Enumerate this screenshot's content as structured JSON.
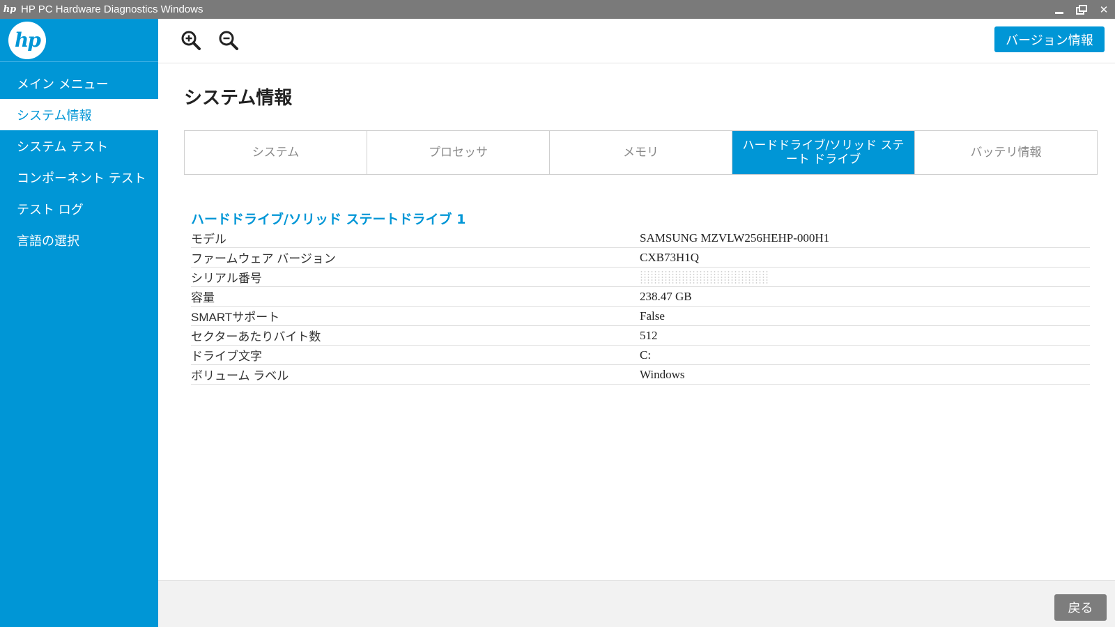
{
  "window": {
    "title": "HP PC Hardware Diagnostics Windows",
    "logo_text": "hp",
    "close_glyph": "✕"
  },
  "sidebar": {
    "logo_text": "hp",
    "items": [
      {
        "label": "メイン メニュー"
      },
      {
        "label": "システム情報"
      },
      {
        "label": "システム テスト"
      },
      {
        "label": "コンポーネント テスト"
      },
      {
        "label": "テスト ログ"
      },
      {
        "label": "言語の選択"
      }
    ]
  },
  "toolbar": {
    "version_label": "バージョン情報",
    "zoom_in_icon": "zoom-in-icon",
    "zoom_out_icon": "zoom-out-icon"
  },
  "main": {
    "title": "システム情報",
    "tabs": [
      {
        "label": "システム"
      },
      {
        "label": "プロセッサ"
      },
      {
        "label": "メモリ"
      },
      {
        "label": "ハードドライブ/ソリッド ステート ドライブ"
      },
      {
        "label": "バッテリ情報"
      }
    ],
    "section_title": "ハードドライブ/ソリッド ステートドライブ 1",
    "rows": [
      {
        "label": "モデル",
        "value": "SAMSUNG MZVLW256HEHP-000H1"
      },
      {
        "label": "ファームウェア バージョン",
        "value": "CXB73H1Q"
      },
      {
        "label": "シリアル番号",
        "value": ""
      },
      {
        "label": "容量",
        "value": "238.47 GB"
      },
      {
        "label": "SMARTサポート",
        "value": "False"
      },
      {
        "label": "セクターあたりバイト数",
        "value": "512"
      },
      {
        "label": "ドライブ文字",
        "value": "C:"
      },
      {
        "label": "ボリューム ラベル",
        "value": "Windows"
      }
    ]
  },
  "footer": {
    "back_label": "戻る"
  },
  "colors": {
    "brand_blue": "#0096d6",
    "titlebar_gray": "#7a7a7a",
    "back_button_gray": "#7d7d7d"
  }
}
